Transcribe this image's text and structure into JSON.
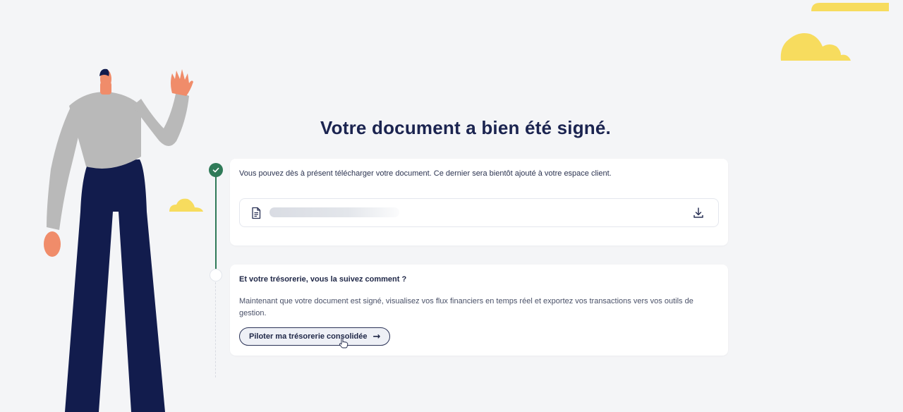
{
  "page": {
    "title": "Votre document a bien été signé."
  },
  "steps": [
    {
      "status": "done",
      "message": "Vous pouvez dès à présent télécharger votre document. Ce dernier sera bientôt ajouté à votre espace client.",
      "document": {
        "file_icon": "file-icon",
        "download_icon": "download-icon"
      }
    },
    {
      "status": "todo",
      "question": "Et votre trésorerie, vous la suivez comment ?",
      "description": "Maintenant que votre document est signé, visualisez vos flux financiers en temps réel et exportez vos transactions vers vos outils de gestion.",
      "cta_label": "Piloter ma trésorerie consolidée",
      "cta_icon": "arrow-right-icon"
    }
  ],
  "colors": {
    "background": "#f4f5f7",
    "title": "#1b2450",
    "step_done": "#2f7a58",
    "cloud": "#f7dc5e",
    "person_shirt": "#b9b9b9",
    "person_pants": "#121c4d",
    "person_skin": "#f08c6a"
  }
}
